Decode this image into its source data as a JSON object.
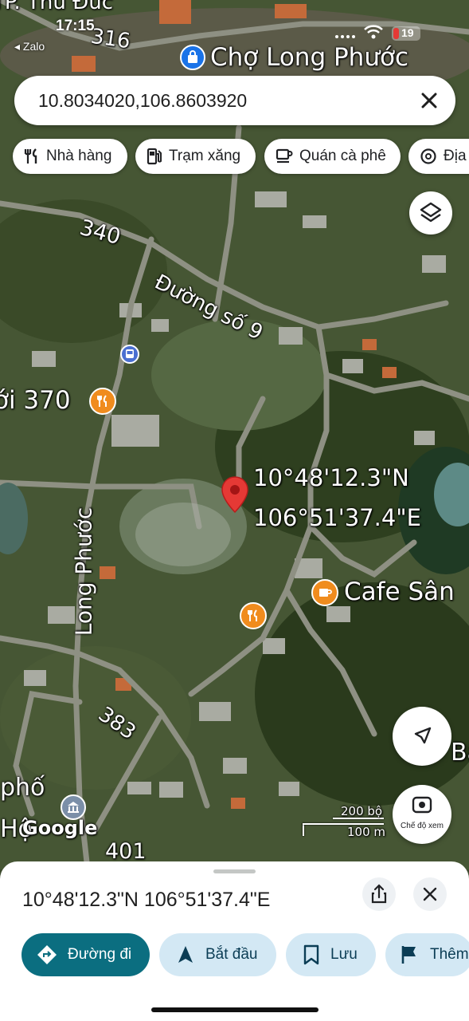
{
  "status": {
    "time": "17:15",
    "back_app": "Zalo",
    "battery": "19"
  },
  "map": {
    "place_labels": {
      "district": "TP. Thủ Đức",
      "market": "Chợ Long Phước",
      "road_340": "340",
      "street_9": "Đường số 9",
      "restaurant_370": "ới 370",
      "street_long_phuoc": "Long Phước",
      "cafe": "Cafe Sân",
      "road_383": "383",
      "road_316": "316",
      "pho": "phố",
      "ho": "Hộ",
      "road_401": "401",
      "ba": "Ba"
    },
    "pin": {
      "lat_dms": "10°48'12.3\"N",
      "lng_dms": "106°51'37.4\"E"
    },
    "scale": {
      "imperial": "200 bộ",
      "metric": "100 m"
    },
    "google_logo": "Google",
    "view_mode_label": "Chế độ xem",
    "icons": [
      "pin-icon",
      "layers-icon",
      "navigate-arrow-icon",
      "camera-view-icon",
      "restaurant-icon",
      "cafe-icon",
      "bus-stop-icon",
      "shopping-bag-icon",
      "government-icon"
    ]
  },
  "search": {
    "value": "10.8034020,106.8603920"
  },
  "chips": [
    {
      "label": "Nhà hàng",
      "icon": "fork-knife-icon"
    },
    {
      "label": "Trạm xăng",
      "icon": "gas-pump-icon"
    },
    {
      "label": "Quán cà phê",
      "icon": "coffee-cup-icon"
    },
    {
      "label": "Địa",
      "icon": "camera-icon"
    }
  ],
  "sheet": {
    "coordinates": "10°48'12.3\"N 106°51'37.4\"E",
    "actions": [
      {
        "label": "Đường đi",
        "icon": "directions-icon"
      },
      {
        "label": "Bắt đầu",
        "icon": "navigation-icon"
      },
      {
        "label": "Lưu",
        "icon": "bookmark-icon"
      },
      {
        "label": "Thêm",
        "icon": "flag-icon"
      }
    ]
  },
  "colors": {
    "primary": "#0b6e80",
    "secondary": "#d3e8f4",
    "pin": "#e53935",
    "poi_orange": "#f08c1e"
  }
}
